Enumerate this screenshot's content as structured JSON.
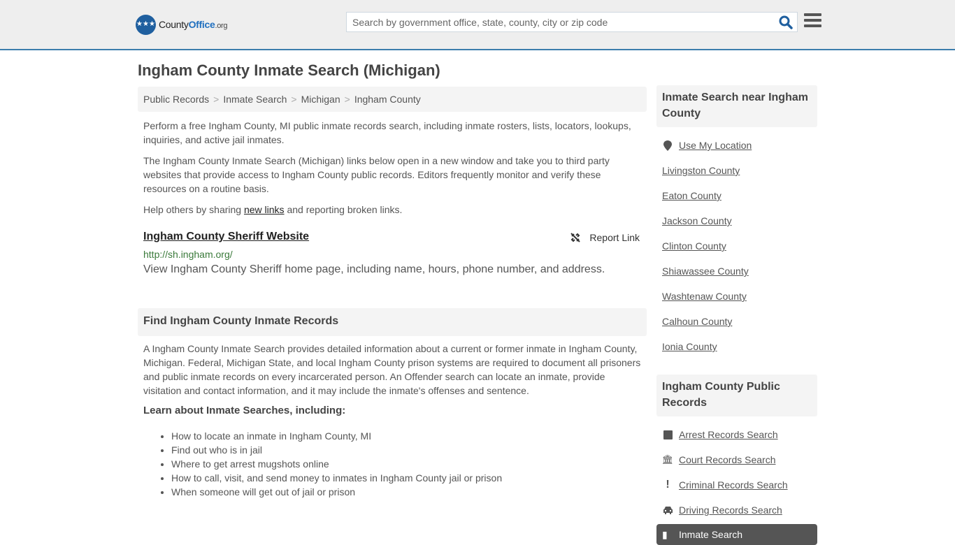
{
  "header": {
    "logo": {
      "county": "County",
      "office": "Office",
      "org": ".org"
    },
    "search_placeholder": "Search by government office, state, county, city or zip code",
    "search_icon": "search-icon",
    "menu_icon": "hamburger-menu-icon"
  },
  "page": {
    "title": "Ingham County Inmate Search (Michigan)",
    "breadcrumb": [
      "Public Records",
      "Inmate Search",
      "Michigan",
      "Ingham County"
    ],
    "intro1": "Perform a free Ingham County, MI public inmate records search, including inmate rosters, lists, locators, lookups, inquiries, and active jail inmates.",
    "intro2": "The Ingham County Inmate Search (Michigan) links below open in a new window and take you to third party websites that provide access to Ingham County public records. Editors frequently monitor and verify these resources on a routine basis.",
    "help_prefix": "Help others by sharing ",
    "help_link": "new links",
    "help_suffix": " and reporting broken links."
  },
  "result": {
    "title": "Ingham County Sheriff Website",
    "url": "http://sh.ingham.org/",
    "description": "View Ingham County Sheriff home page, including name, hours, phone number, and address.",
    "report_label": "Report Link"
  },
  "find_section": {
    "heading": "Find Ingham County Inmate Records",
    "body": "A Ingham County Inmate Search provides detailed information about a current or former inmate in Ingham County, Michigan. Federal, Michigan State, and local Ingham County prison systems are required to document all prisoners and public inmate records on every incarcerated person. An Offender search can locate an inmate, provide visitation and contact information, and it may include the inmate's offenses and sentence.",
    "learn_heading": "Learn about Inmate Searches, including:",
    "items": [
      "How to locate an inmate in Ingham County, MI",
      "Find out who is in jail",
      "Where to get arrest mugshots online",
      "How to call, visit, and send money to inmates in Ingham County jail or prison",
      "When someone will get out of jail or prison"
    ]
  },
  "sidebar": {
    "nearby_heading": "Inmate Search near Ingham County",
    "use_location": "Use My Location",
    "nearby": [
      "Livingston County",
      "Eaton County",
      "Jackson County",
      "Clinton County",
      "Shiawassee County",
      "Washtenaw County",
      "Calhoun County",
      "Ionia County"
    ],
    "records_heading": "Ingham County Public Records",
    "records": [
      {
        "label": "Arrest Records Search",
        "icon": "square-icon"
      },
      {
        "label": "Court Records Search",
        "icon": "courthouse-icon"
      },
      {
        "label": "Criminal Records Search",
        "icon": "exclamation-icon"
      },
      {
        "label": "Driving Records Search",
        "icon": "car-icon"
      }
    ],
    "active_item": "Inmate Search"
  }
}
